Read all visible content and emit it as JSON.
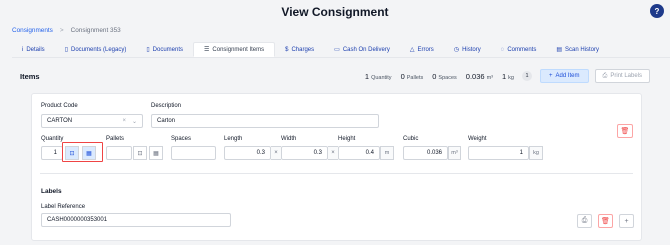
{
  "breadcrumb": {
    "root": "Consignments",
    "separator": ">",
    "current": "Consignment 353"
  },
  "page_title": "View Consignment",
  "help_label": "?",
  "tabs": [
    {
      "label": "Details",
      "icon": "i"
    },
    {
      "label": "Documents (Legacy)",
      "icon": "▯"
    },
    {
      "label": "Documents",
      "icon": "▯"
    },
    {
      "label": "Consignment Items",
      "icon": "☰"
    },
    {
      "label": "Charges",
      "icon": "$"
    },
    {
      "label": "Cash On Delivery",
      "icon": "▭"
    },
    {
      "label": "Errors",
      "icon": "△"
    },
    {
      "label": "History",
      "icon": "◷"
    },
    {
      "label": "Comments",
      "icon": "◌"
    },
    {
      "label": "Scan History",
      "icon": "▤"
    }
  ],
  "items_header": {
    "title": "Items",
    "quantity_value": "1",
    "quantity_label": "Quantity",
    "pallets_value": "0",
    "pallets_label": "Pallets",
    "spaces_value": "0",
    "spaces_label": "Spaces",
    "volume_value": "0.036",
    "volume_label": "m³",
    "weight_value": "1",
    "weight_label": "kg",
    "item_count": "1",
    "add_item_label": "Add Item",
    "print_labels_label": "Print Labels"
  },
  "form": {
    "product_code_label": "Product Code",
    "product_code_value": "CARTON",
    "description_label": "Description",
    "description_value": "Carton",
    "quantity_label": "Quantity",
    "quantity_value": "1",
    "pallets_label": "Pallets",
    "pallets_value": "",
    "spaces_label": "Spaces",
    "spaces_value": "",
    "length_label": "Length",
    "length_value": "0.3",
    "width_label": "Width",
    "width_value": "0.3",
    "height_label": "Height",
    "height_value": "0.4",
    "dim_unit": "m",
    "cubic_label": "Cubic",
    "cubic_value": "0.036",
    "cubic_unit": "m³",
    "weight_label": "Weight",
    "weight_value": "1",
    "weight_unit": "kg",
    "times_sign": "×"
  },
  "labels": {
    "section_title": "Labels",
    "label_reference_label": "Label Reference",
    "label_reference_value": "CASH0000000353001"
  },
  "colors": {
    "accent": "#2563eb",
    "danger": "#ef4444",
    "highlight": "#dbeafe"
  }
}
